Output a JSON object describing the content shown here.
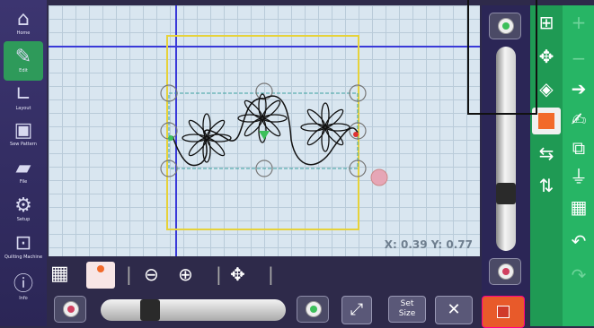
{
  "sidebar": {
    "items": [
      {
        "label": "Home",
        "icon": "home-icon"
      },
      {
        "label": "Edit",
        "icon": "edit-icon",
        "active": true
      },
      {
        "label": "Layout",
        "icon": "layout-icon"
      },
      {
        "label": "Sew Pattern",
        "icon": "sew-icon"
      },
      {
        "label": "File",
        "icon": "folder-icon"
      },
      {
        "label": "Setup",
        "icon": "gears-icon"
      },
      {
        "label": "Quilting Machine",
        "icon": "machine-icon"
      },
      {
        "label": "Info",
        "icon": "info-icon"
      }
    ]
  },
  "canvas": {
    "coordinates": "X: 0.39 Y: 0.77"
  },
  "bottom_toolbar": {
    "set_size_line1": "Set",
    "set_size_line2": "Size"
  },
  "colors": {
    "green_strip": "#1f9a54",
    "selected_tool_accent": "#f26a2a",
    "sidebar": "#2b2656",
    "canvas": "#d9e6f0"
  }
}
